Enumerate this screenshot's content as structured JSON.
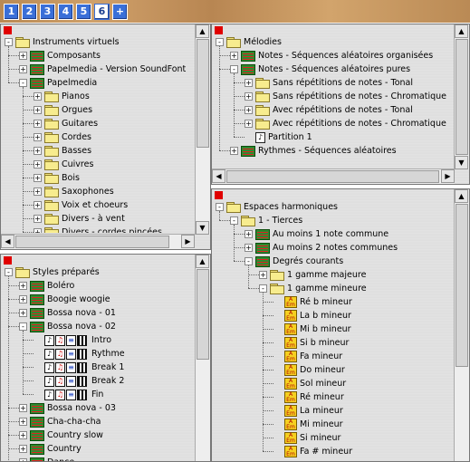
{
  "tabs": [
    "1",
    "2",
    "3",
    "4",
    "5",
    "6",
    "+"
  ],
  "active_tab": "6",
  "left_top": {
    "items": [
      {
        "depth": 0,
        "expander": "-",
        "icon": "folder",
        "label": "Instruments virtuels"
      },
      {
        "depth": 1,
        "expander": "+",
        "icon": "seq",
        "label": "Composants"
      },
      {
        "depth": 1,
        "expander": "+",
        "icon": "seq",
        "label": "Papelmedia - Version SoundFont"
      },
      {
        "depth": 1,
        "expander": "-",
        "icon": "seq",
        "label": "Papelmedia"
      },
      {
        "depth": 2,
        "expander": "+",
        "icon": "folder",
        "label": "Pianos"
      },
      {
        "depth": 2,
        "expander": "+",
        "icon": "folder",
        "label": "Orgues"
      },
      {
        "depth": 2,
        "expander": "+",
        "icon": "folder",
        "label": "Guitares"
      },
      {
        "depth": 2,
        "expander": "+",
        "icon": "folder",
        "label": "Cordes"
      },
      {
        "depth": 2,
        "expander": "+",
        "icon": "folder",
        "label": "Basses"
      },
      {
        "depth": 2,
        "expander": "+",
        "icon": "folder",
        "label": "Cuivres"
      },
      {
        "depth": 2,
        "expander": "+",
        "icon": "folder",
        "label": "Bois"
      },
      {
        "depth": 2,
        "expander": "+",
        "icon": "folder",
        "label": "Saxophones"
      },
      {
        "depth": 2,
        "expander": "+",
        "icon": "folder",
        "label": "Voix et choeurs"
      },
      {
        "depth": 2,
        "expander": "+",
        "icon": "folder",
        "label": "Divers - à vent"
      },
      {
        "depth": 2,
        "expander": "+",
        "icon": "folder",
        "label": "Divers - cordes pincées"
      }
    ]
  },
  "left_bottom": {
    "items": [
      {
        "depth": 0,
        "expander": "-",
        "icon": "folder",
        "label": "Styles préparés"
      },
      {
        "depth": 1,
        "expander": "+",
        "icon": "seq",
        "label": "Boléro"
      },
      {
        "depth": 1,
        "expander": "+",
        "icon": "seq",
        "label": "Boogie woogie"
      },
      {
        "depth": 1,
        "expander": "+",
        "icon": "seq",
        "label": "Bossa nova - 01"
      },
      {
        "depth": 1,
        "expander": "-",
        "icon": "seq",
        "label": "Bossa nova - 02"
      },
      {
        "depth": 2,
        "expander": "",
        "icon": "tracks",
        "label": "Intro"
      },
      {
        "depth": 2,
        "expander": "",
        "icon": "tracks",
        "label": "Rythme"
      },
      {
        "depth": 2,
        "expander": "",
        "icon": "tracks",
        "label": "Break 1"
      },
      {
        "depth": 2,
        "expander": "",
        "icon": "tracks",
        "label": "Break 2"
      },
      {
        "depth": 2,
        "expander": "",
        "icon": "tracks",
        "label": "Fin"
      },
      {
        "depth": 1,
        "expander": "+",
        "icon": "seq",
        "label": "Bossa nova - 03"
      },
      {
        "depth": 1,
        "expander": "+",
        "icon": "seq",
        "label": "Cha-cha-cha"
      },
      {
        "depth": 1,
        "expander": "+",
        "icon": "seq",
        "label": "Country slow"
      },
      {
        "depth": 1,
        "expander": "+",
        "icon": "seq",
        "label": "Country"
      },
      {
        "depth": 1,
        "expander": "+",
        "icon": "seq",
        "label": "Dance"
      }
    ]
  },
  "right_top": {
    "items": [
      {
        "depth": 0,
        "expander": "-",
        "icon": "folder",
        "label": "Mélodies"
      },
      {
        "depth": 1,
        "expander": "+",
        "icon": "seq",
        "label": "Notes - Séquences aléatoires organisées"
      },
      {
        "depth": 1,
        "expander": "-",
        "icon": "seq",
        "label": "Notes - Séquences aléatoires pures"
      },
      {
        "depth": 2,
        "expander": "+",
        "icon": "folder",
        "label": "Sans répétitions de notes - Tonal"
      },
      {
        "depth": 2,
        "expander": "+",
        "icon": "folder",
        "label": "Sans répétitions de notes - Chromatique"
      },
      {
        "depth": 2,
        "expander": "+",
        "icon": "folder",
        "label": "Avec répétitions de notes - Tonal"
      },
      {
        "depth": 2,
        "expander": "+",
        "icon": "folder",
        "label": "Avec répétitions de notes - Chromatique"
      },
      {
        "depth": 2,
        "expander": "",
        "icon": "note",
        "label": "Partition 1"
      },
      {
        "depth": 1,
        "expander": "+",
        "icon": "seq",
        "label": "Rythmes - Séquences aléatoires"
      }
    ]
  },
  "right_bottom": {
    "items": [
      {
        "depth": 0,
        "expander": "-",
        "icon": "folder",
        "label": "Espaces harmoniques"
      },
      {
        "depth": 1,
        "expander": "-",
        "icon": "folder",
        "label": "1 - Tierces"
      },
      {
        "depth": 2,
        "expander": "+",
        "icon": "seq",
        "label": "Au moins 1 note commune"
      },
      {
        "depth": 2,
        "expander": "+",
        "icon": "seq",
        "label": "Au moins 2 notes communes"
      },
      {
        "depth": 2,
        "expander": "-",
        "icon": "seq",
        "label": "Degrés courants"
      },
      {
        "depth": 3,
        "expander": "+",
        "icon": "folder",
        "label": "1 gamme majeure"
      },
      {
        "depth": 3,
        "expander": "-",
        "icon": "folder",
        "label": "1 gamme mineure"
      },
      {
        "depth": 4,
        "expander": "",
        "icon": "harm",
        "label": "Ré b mineur"
      },
      {
        "depth": 4,
        "expander": "",
        "icon": "harm",
        "label": "La b mineur"
      },
      {
        "depth": 4,
        "expander": "",
        "icon": "harm",
        "label": "Mi b mineur"
      },
      {
        "depth": 4,
        "expander": "",
        "icon": "harm",
        "label": "Si b mineur"
      },
      {
        "depth": 4,
        "expander": "",
        "icon": "harm",
        "label": "Fa mineur"
      },
      {
        "depth": 4,
        "expander": "",
        "icon": "harm",
        "label": "Do mineur"
      },
      {
        "depth": 4,
        "expander": "",
        "icon": "harm",
        "label": "Sol mineur"
      },
      {
        "depth": 4,
        "expander": "",
        "icon": "harm",
        "label": "Ré mineur"
      },
      {
        "depth": 4,
        "expander": "",
        "icon": "harm",
        "label": "La mineur"
      },
      {
        "depth": 4,
        "expander": "",
        "icon": "harm",
        "label": "Mi mineur"
      },
      {
        "depth": 4,
        "expander": "",
        "icon": "harm",
        "label": "Si mineur"
      },
      {
        "depth": 4,
        "expander": "",
        "icon": "harm",
        "label": "Fa # mineur"
      }
    ]
  }
}
